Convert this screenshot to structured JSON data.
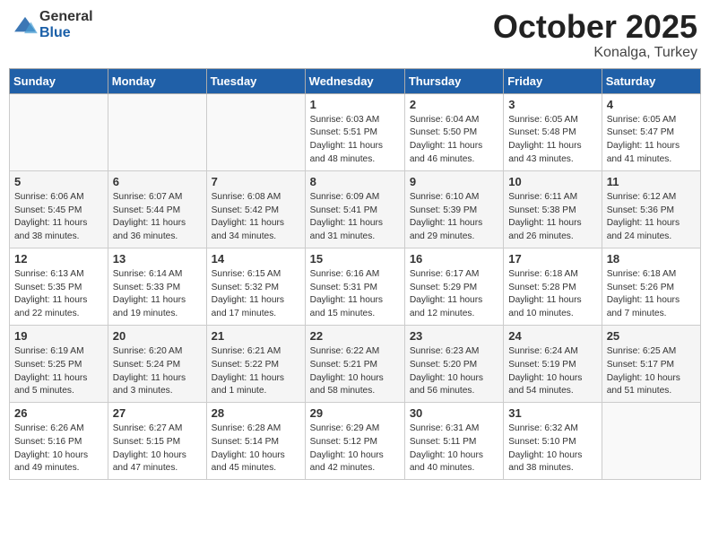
{
  "header": {
    "logo_general": "General",
    "logo_blue": "Blue",
    "month": "October 2025",
    "location": "Konalga, Turkey"
  },
  "weekdays": [
    "Sunday",
    "Monday",
    "Tuesday",
    "Wednesday",
    "Thursday",
    "Friday",
    "Saturday"
  ],
  "weeks": [
    [
      {
        "day": "",
        "info": ""
      },
      {
        "day": "",
        "info": ""
      },
      {
        "day": "",
        "info": ""
      },
      {
        "day": "1",
        "info": "Sunrise: 6:03 AM\nSunset: 5:51 PM\nDaylight: 11 hours\nand 48 minutes."
      },
      {
        "day": "2",
        "info": "Sunrise: 6:04 AM\nSunset: 5:50 PM\nDaylight: 11 hours\nand 46 minutes."
      },
      {
        "day": "3",
        "info": "Sunrise: 6:05 AM\nSunset: 5:48 PM\nDaylight: 11 hours\nand 43 minutes."
      },
      {
        "day": "4",
        "info": "Sunrise: 6:05 AM\nSunset: 5:47 PM\nDaylight: 11 hours\nand 41 minutes."
      }
    ],
    [
      {
        "day": "5",
        "info": "Sunrise: 6:06 AM\nSunset: 5:45 PM\nDaylight: 11 hours\nand 38 minutes."
      },
      {
        "day": "6",
        "info": "Sunrise: 6:07 AM\nSunset: 5:44 PM\nDaylight: 11 hours\nand 36 minutes."
      },
      {
        "day": "7",
        "info": "Sunrise: 6:08 AM\nSunset: 5:42 PM\nDaylight: 11 hours\nand 34 minutes."
      },
      {
        "day": "8",
        "info": "Sunrise: 6:09 AM\nSunset: 5:41 PM\nDaylight: 11 hours\nand 31 minutes."
      },
      {
        "day": "9",
        "info": "Sunrise: 6:10 AM\nSunset: 5:39 PM\nDaylight: 11 hours\nand 29 minutes."
      },
      {
        "day": "10",
        "info": "Sunrise: 6:11 AM\nSunset: 5:38 PM\nDaylight: 11 hours\nand 26 minutes."
      },
      {
        "day": "11",
        "info": "Sunrise: 6:12 AM\nSunset: 5:36 PM\nDaylight: 11 hours\nand 24 minutes."
      }
    ],
    [
      {
        "day": "12",
        "info": "Sunrise: 6:13 AM\nSunset: 5:35 PM\nDaylight: 11 hours\nand 22 minutes."
      },
      {
        "day": "13",
        "info": "Sunrise: 6:14 AM\nSunset: 5:33 PM\nDaylight: 11 hours\nand 19 minutes."
      },
      {
        "day": "14",
        "info": "Sunrise: 6:15 AM\nSunset: 5:32 PM\nDaylight: 11 hours\nand 17 minutes."
      },
      {
        "day": "15",
        "info": "Sunrise: 6:16 AM\nSunset: 5:31 PM\nDaylight: 11 hours\nand 15 minutes."
      },
      {
        "day": "16",
        "info": "Sunrise: 6:17 AM\nSunset: 5:29 PM\nDaylight: 11 hours\nand 12 minutes."
      },
      {
        "day": "17",
        "info": "Sunrise: 6:18 AM\nSunset: 5:28 PM\nDaylight: 11 hours\nand 10 minutes."
      },
      {
        "day": "18",
        "info": "Sunrise: 6:18 AM\nSunset: 5:26 PM\nDaylight: 11 hours\nand 7 minutes."
      }
    ],
    [
      {
        "day": "19",
        "info": "Sunrise: 6:19 AM\nSunset: 5:25 PM\nDaylight: 11 hours\nand 5 minutes."
      },
      {
        "day": "20",
        "info": "Sunrise: 6:20 AM\nSunset: 5:24 PM\nDaylight: 11 hours\nand 3 minutes."
      },
      {
        "day": "21",
        "info": "Sunrise: 6:21 AM\nSunset: 5:22 PM\nDaylight: 11 hours\nand 1 minute."
      },
      {
        "day": "22",
        "info": "Sunrise: 6:22 AM\nSunset: 5:21 PM\nDaylight: 10 hours\nand 58 minutes."
      },
      {
        "day": "23",
        "info": "Sunrise: 6:23 AM\nSunset: 5:20 PM\nDaylight: 10 hours\nand 56 minutes."
      },
      {
        "day": "24",
        "info": "Sunrise: 6:24 AM\nSunset: 5:19 PM\nDaylight: 10 hours\nand 54 minutes."
      },
      {
        "day": "25",
        "info": "Sunrise: 6:25 AM\nSunset: 5:17 PM\nDaylight: 10 hours\nand 51 minutes."
      }
    ],
    [
      {
        "day": "26",
        "info": "Sunrise: 6:26 AM\nSunset: 5:16 PM\nDaylight: 10 hours\nand 49 minutes."
      },
      {
        "day": "27",
        "info": "Sunrise: 6:27 AM\nSunset: 5:15 PM\nDaylight: 10 hours\nand 47 minutes."
      },
      {
        "day": "28",
        "info": "Sunrise: 6:28 AM\nSunset: 5:14 PM\nDaylight: 10 hours\nand 45 minutes."
      },
      {
        "day": "29",
        "info": "Sunrise: 6:29 AM\nSunset: 5:12 PM\nDaylight: 10 hours\nand 42 minutes."
      },
      {
        "day": "30",
        "info": "Sunrise: 6:31 AM\nSunset: 5:11 PM\nDaylight: 10 hours\nand 40 minutes."
      },
      {
        "day": "31",
        "info": "Sunrise: 6:32 AM\nSunset: 5:10 PM\nDaylight: 10 hours\nand 38 minutes."
      },
      {
        "day": "",
        "info": ""
      }
    ]
  ]
}
